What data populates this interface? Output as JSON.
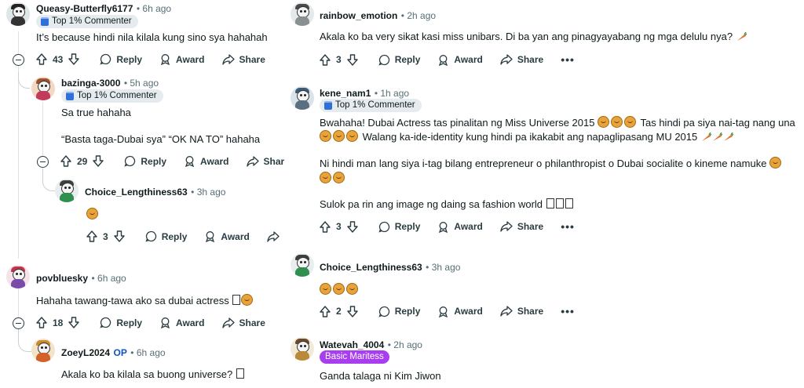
{
  "left": {
    "c1": {
      "user": "Queasy-Butterfly6177",
      "time": "6h ago",
      "flair": "Top 1% Commenter",
      "text": "It’s because hindi nila kilala kung sino sya hahahah",
      "votes": "43",
      "reply": "Reply",
      "award": "Award",
      "share": "Share"
    },
    "c2": {
      "user": "bazinga-3000",
      "time": "5h ago",
      "flair": "Top 1% Commenter",
      "line1": "Sa true hahaha",
      "line2": "“Basta taga-Dubai sya” “OK NA TO” hahaha",
      "votes": "29",
      "reply": "Reply",
      "award": "Award",
      "share": "Shar"
    },
    "c3": {
      "user": "Choice_Lengthiness63",
      "time": "3h ago",
      "votes": "3",
      "reply": "Reply",
      "award": "Award"
    },
    "c4": {
      "user": "povbluesky",
      "time": "6h ago",
      "text": "Hahaha tawang-tawa ako sa dubai actress",
      "votes": "18",
      "reply": "Reply",
      "award": "Award",
      "share": "Share"
    },
    "c5": {
      "user": "ZoeyL2024",
      "op": "OP",
      "time": "6h ago",
      "text": "Akala ko ba kilala sa buong universe?"
    }
  },
  "right": {
    "c1": {
      "user": "rainbow_emotion",
      "time": "2h ago",
      "text": "Akala ko ba very sikat kasi miss unibars. Di ba yan ang pinagyayabang ng mga delulu nya?",
      "votes": "3",
      "reply": "Reply",
      "award": "Award",
      "share": "Share",
      "more": "•••"
    },
    "c2": {
      "user": "kene_nam1",
      "time": "1h ago",
      "flair": "Top 1% Commenter",
      "l1a": "Bwahaha! Dubai Actress tas pinalitan ng Miss Universe 2015",
      "l1b": "Tas hindi pa siya nai-tag nang una",
      "l2": "Walang ka-ide-identity kung hindi pa ikakabit ang napaglipasang MU 2015",
      "l3": "Ni hindi man lang siya i-tag bilang entrepreneur o philanthropist o Dubai socialite o kineme namuke",
      "l4": "Sulok pa rin ang image ng daing sa fashion world",
      "votes": "3",
      "reply": "Reply",
      "award": "Award",
      "share": "Share",
      "more": "•••"
    },
    "c3": {
      "user": "Choice_Lengthiness63",
      "time": "3h ago",
      "votes": "2",
      "reply": "Reply",
      "award": "Award",
      "share": "Share",
      "more": "•••"
    },
    "c4": {
      "user": "Watevah_4004",
      "time": "2h ago",
      "flair": "Basic Maritess",
      "text": "Ganda talaga ni Kim Jiwon"
    }
  },
  "colors": {
    "flair_purple": "#a93ef0",
    "flair_gray": "#e5ebee",
    "meta": "#576f76"
  },
  "icons": [
    "upvote-icon",
    "downvote-icon",
    "reply-bubble-icon",
    "award-icon",
    "share-arrow-icon",
    "collapse-icon",
    "more-icon"
  ]
}
